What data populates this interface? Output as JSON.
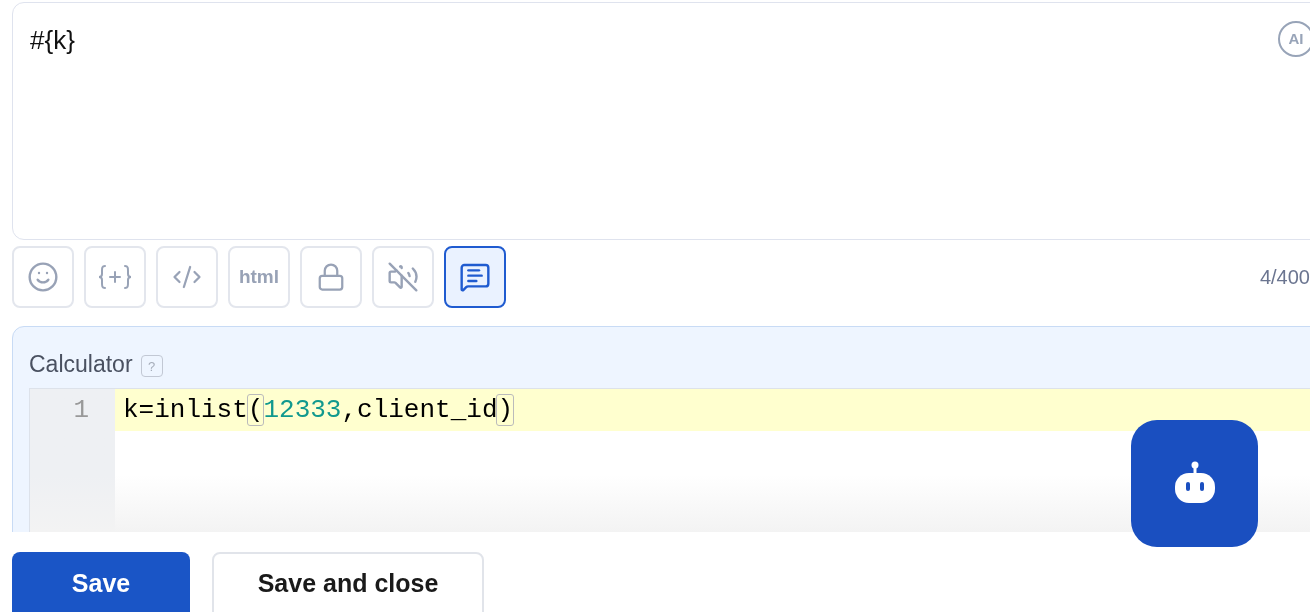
{
  "message_field": {
    "value": "#{k}",
    "ai_badge": "AI"
  },
  "toolbar": {
    "buttons": [
      {
        "kind": "emoji",
        "selected": false
      },
      {
        "kind": "variable",
        "selected": false
      },
      {
        "kind": "code",
        "selected": false
      },
      {
        "kind": "html",
        "label": "html",
        "selected": false
      },
      {
        "kind": "lock",
        "selected": false
      },
      {
        "kind": "mute",
        "selected": false
      },
      {
        "kind": "comment",
        "selected": true
      }
    ],
    "counter": "4/400"
  },
  "calculator": {
    "label": "Calculator",
    "help": "?",
    "lines": [
      {
        "number": "1",
        "active": true,
        "tokens": [
          {
            "kind": "text",
            "text": "k=inlist"
          },
          {
            "kind": "bracket",
            "text": "("
          },
          {
            "kind": "number",
            "text": "12333"
          },
          {
            "kind": "text",
            "text": ",client_id"
          },
          {
            "kind": "bracket",
            "text": ")"
          }
        ]
      }
    ]
  },
  "footer": {
    "buttons": [
      {
        "label": "Save",
        "primary": true
      },
      {
        "label": "Save and close",
        "primary": false
      }
    ]
  }
}
